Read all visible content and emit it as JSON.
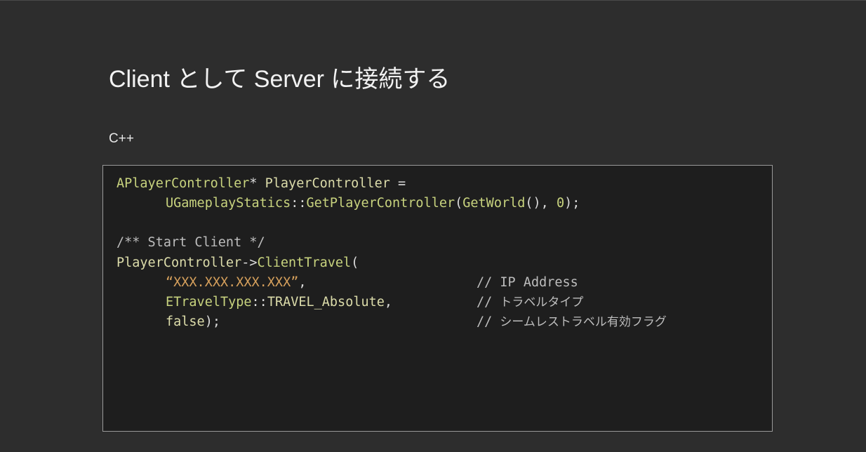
{
  "slide": {
    "title": "Client として Server に接続する",
    "language_label": "C++"
  },
  "code": {
    "line1": {
      "type": "APlayerController",
      "star": "*",
      "var": "PlayerController",
      "assign": " ="
    },
    "line2": {
      "cls": "UGameplayStatics",
      "scope": "::",
      "fn": "GetPlayerController",
      "open": "(",
      "arg1": "GetWorld",
      "parens": "()",
      "comma": ", ",
      "num": "0",
      "close": ");"
    },
    "line4": {
      "comment": "/** Start Client */"
    },
    "line5": {
      "var": "PlayerController",
      "arrow": "->",
      "fn": "ClientTravel",
      "open": "("
    },
    "line6": {
      "str": "“XXX.XXX.XXX.XXX”",
      "comma": ",",
      "comment": "// IP Address"
    },
    "line7": {
      "enum": "ETravelType",
      "scope": "::",
      "value": "TRAVEL_Absolute",
      "comma": ",",
      "comment_prefix": "// ",
      "comment": "トラベルタイプ"
    },
    "line8": {
      "kw": "false",
      "close": ");",
      "comment_prefix": "// ",
      "comment": "シームレストラベル有効フラグ"
    }
  },
  "colors": {
    "background": "#2d2d2d",
    "code_background": "#1e1e1e",
    "code_border": "#9a9a9a",
    "type": "#c8d37e",
    "function": "#dcdcaa",
    "string": "#d6a05c",
    "comment": "#bdbdbd",
    "text": "#dcdcdc"
  }
}
